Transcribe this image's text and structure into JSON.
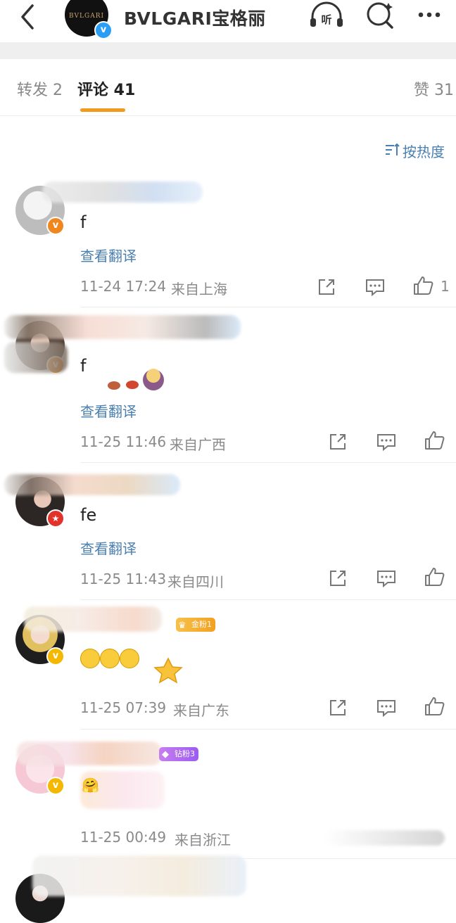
{
  "header": {
    "title": "BVLGARI宝格丽",
    "logo_text": "BVLGARI"
  },
  "tabs": {
    "repost": "转发 2",
    "comments": "评论 41",
    "likes": "赞 31"
  },
  "sort_label": "按热度",
  "comments": [
    {
      "text": "f",
      "translate": "查看翻译",
      "time": "11-24 17:24",
      "location": "来自上海",
      "likes": "1"
    },
    {
      "text": "f",
      "translate": "查看翻译",
      "time": "11-25 11:46",
      "location": "来自广西",
      "likes": ""
    },
    {
      "text": "fe",
      "translate": "查看翻译",
      "time": "11-25 11:43",
      "location": "来自四川",
      "likes": ""
    },
    {
      "text": "",
      "translate": "",
      "time": "11-25 07:39",
      "location": "来自广东",
      "likes": "",
      "badge": "金粉1"
    },
    {
      "text": "",
      "translate": "",
      "time": "11-25 00:49",
      "location": "来自浙江",
      "likes": "",
      "badge": "钻粉3"
    }
  ],
  "colors": {
    "accent": "#f29a1d",
    "link": "#4a7fb0",
    "verified_blue": "#2a9df4"
  }
}
